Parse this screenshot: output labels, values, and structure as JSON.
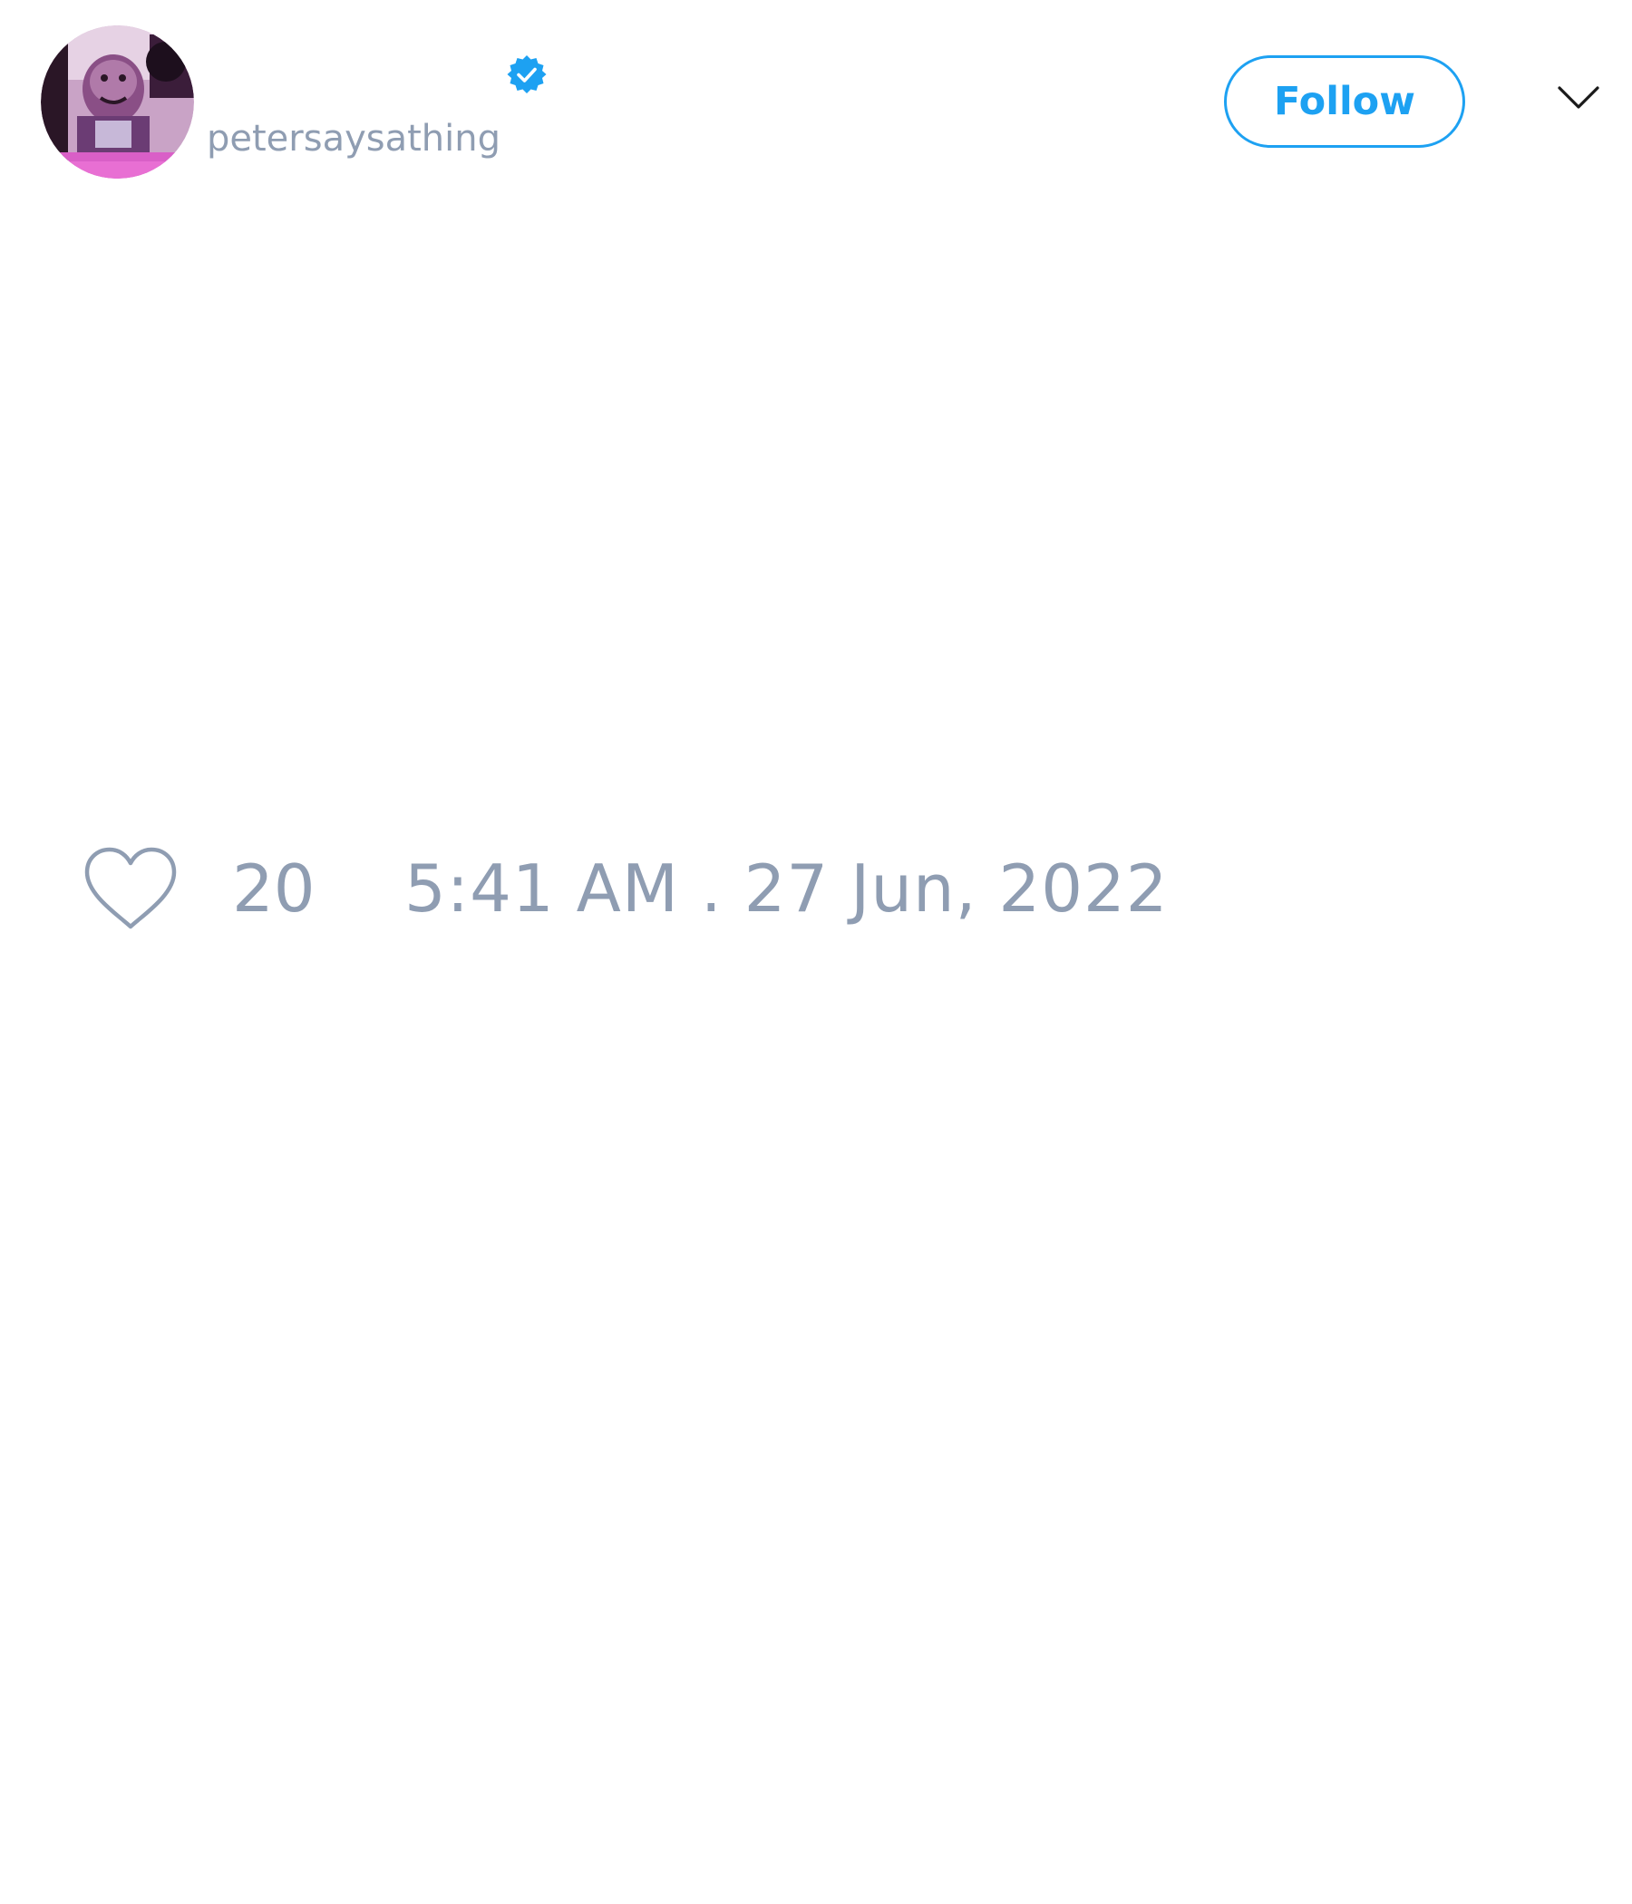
{
  "user": {
    "handle": "petersaysathing",
    "verified": true,
    "verified_icon": "verified-badge-icon",
    "avatar_icon": "avatar-cartoon-character"
  },
  "actions": {
    "follow_label": "Follow",
    "menu_icon": "chevron-down-icon"
  },
  "engagement": {
    "like_icon": "heart-outline-icon",
    "like_count": "20"
  },
  "meta": {
    "timestamp": "5:41 AM . 27 Jun, 2022"
  },
  "colors": {
    "accent": "#1da1f2",
    "muted_text": "#8f9db2",
    "background": "#ffffff"
  }
}
